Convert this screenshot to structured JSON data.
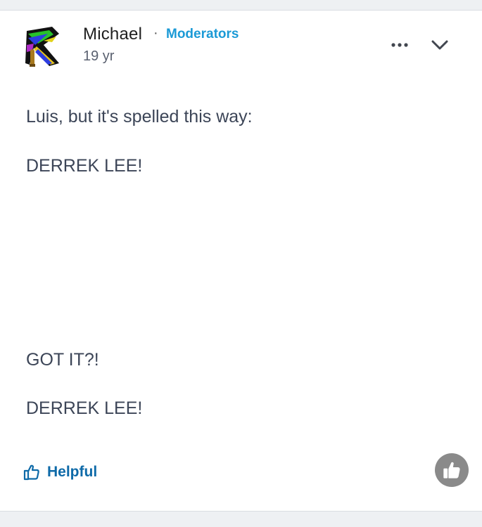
{
  "post": {
    "author": "Michael",
    "separator": "·",
    "role": "Moderators",
    "time": "19 yr",
    "lines": [
      "Luis, but it's spelled this way:",
      "DERREK LEE!",
      "GOT IT?!",
      "DERREK LEE!"
    ]
  },
  "actions": {
    "helpful_label": "Helpful"
  },
  "icons": {
    "more": "more-horizontal-icon",
    "collapse": "chevron-down-icon",
    "helpful": "thumbs-up-outline-icon",
    "fab": "thumbs-up-filled-icon"
  },
  "colors": {
    "role": "#1b9ad6",
    "helpful": "#0e6aa8",
    "body_text": "#3c4557",
    "fab_bg": "#8a8a8a"
  }
}
